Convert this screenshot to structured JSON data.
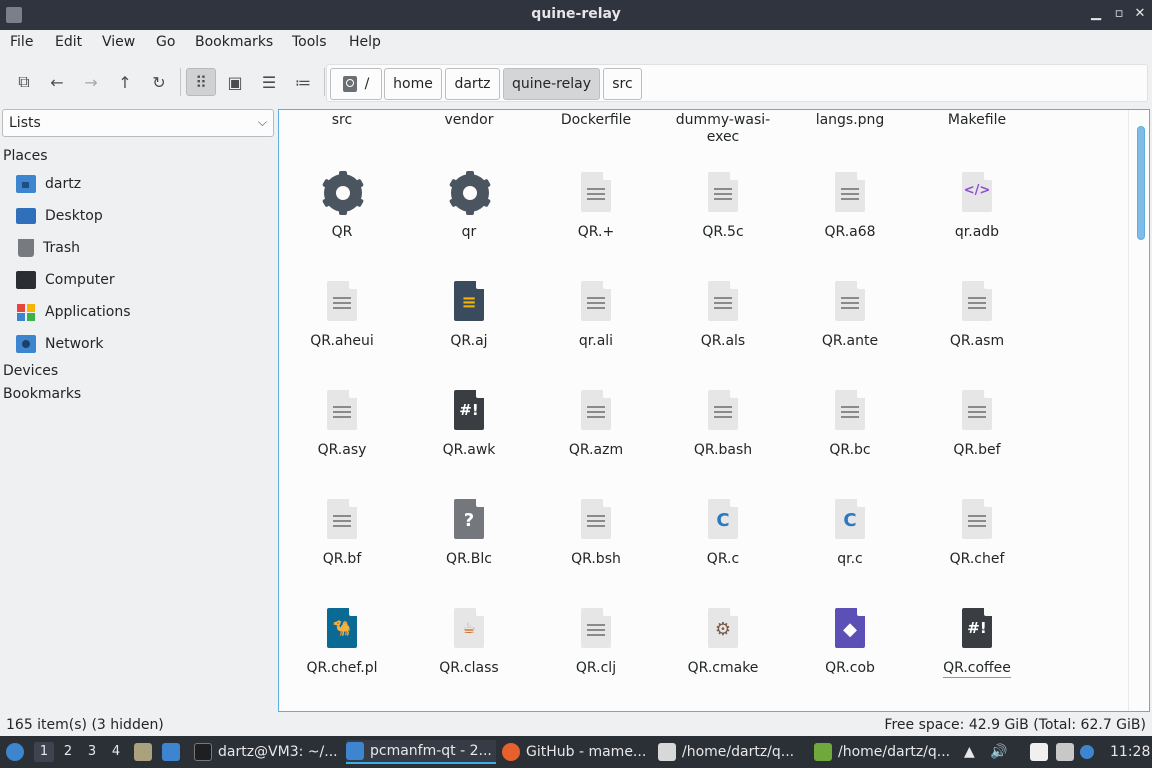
{
  "window": {
    "title": "quine-relay"
  },
  "menu": [
    "File",
    "Edit",
    "View",
    "Go",
    "Bookmarks",
    "Tools",
    "Help"
  ],
  "breadcrumb": {
    "root": "/",
    "items": [
      "home",
      "dartz",
      "quine-relay",
      "src"
    ],
    "current_index": 2
  },
  "side": {
    "select_value": "Lists",
    "places_header": "Places",
    "places": [
      "dartz",
      "Desktop",
      "Trash",
      "Computer",
      "Applications",
      "Network"
    ],
    "devices_header": "Devices",
    "bookmarks_header": "Bookmarks"
  },
  "files_top": [
    "src",
    "vendor",
    "Dockerfile",
    "dummy-wasi-exec",
    "langs.png",
    "Makefile"
  ],
  "files": [
    {
      "name": "QR",
      "icon": "gear-icon"
    },
    {
      "name": "qr",
      "icon": "gear-icon"
    },
    {
      "name": "QR.+",
      "icon": "text-file-icon"
    },
    {
      "name": "QR.5c",
      "icon": "text-file-icon"
    },
    {
      "name": "QR.a68",
      "icon": "text-file-icon"
    },
    {
      "name": "qr.adb",
      "icon": "code-file-icon"
    },
    {
      "name": "QR.aheui",
      "icon": "text-file-icon"
    },
    {
      "name": "QR.aj",
      "icon": "source-file-icon"
    },
    {
      "name": "qr.ali",
      "icon": "text-file-icon"
    },
    {
      "name": "QR.als",
      "icon": "text-file-icon"
    },
    {
      "name": "QR.ante",
      "icon": "text-file-icon"
    },
    {
      "name": "QR.asm",
      "icon": "text-file-icon"
    },
    {
      "name": "QR.asy",
      "icon": "text-file-icon"
    },
    {
      "name": "QR.awk",
      "icon": "script-file-icon"
    },
    {
      "name": "QR.azm",
      "icon": "text-file-icon"
    },
    {
      "name": "QR.bash",
      "icon": "text-file-icon"
    },
    {
      "name": "QR.bc",
      "icon": "text-file-icon"
    },
    {
      "name": "QR.bef",
      "icon": "text-file-icon"
    },
    {
      "name": "QR.bf",
      "icon": "text-file-icon"
    },
    {
      "name": "QR.Blc",
      "icon": "unknown-file-icon"
    },
    {
      "name": "QR.bsh",
      "icon": "text-file-icon"
    },
    {
      "name": "QR.c",
      "icon": "c-file-icon"
    },
    {
      "name": "qr.c",
      "icon": "c-file-icon"
    },
    {
      "name": "QR.chef",
      "icon": "text-file-icon"
    },
    {
      "name": "QR.chef.pl",
      "icon": "perl-file-icon"
    },
    {
      "name": "QR.class",
      "icon": "java-file-icon"
    },
    {
      "name": "QR.clj",
      "icon": "text-file-icon"
    },
    {
      "name": "QR.cmake",
      "icon": "cmake-file-icon"
    },
    {
      "name": "QR.cob",
      "icon": "cobol-file-icon"
    },
    {
      "name": "QR.coffee",
      "icon": "script-file-icon"
    }
  ],
  "status": {
    "left": "165 item(s) (3 hidden)",
    "right": "Free space: 42.9 GiB (Total: 62.7 GiB)"
  },
  "taskbar": {
    "workspaces": [
      "1",
      "2",
      "3",
      "4"
    ],
    "tasks": [
      "dartz@VM3: ~/...",
      "pcmanfm-qt - 2...",
      "GitHub - mame...",
      "/home/dartz/q...",
      "/home/dartz/q..."
    ],
    "clock": "11:28"
  },
  "colors": {
    "accent": "#3daee9",
    "titlebar": "#2f343f",
    "taskbar": "#2b2f36"
  }
}
